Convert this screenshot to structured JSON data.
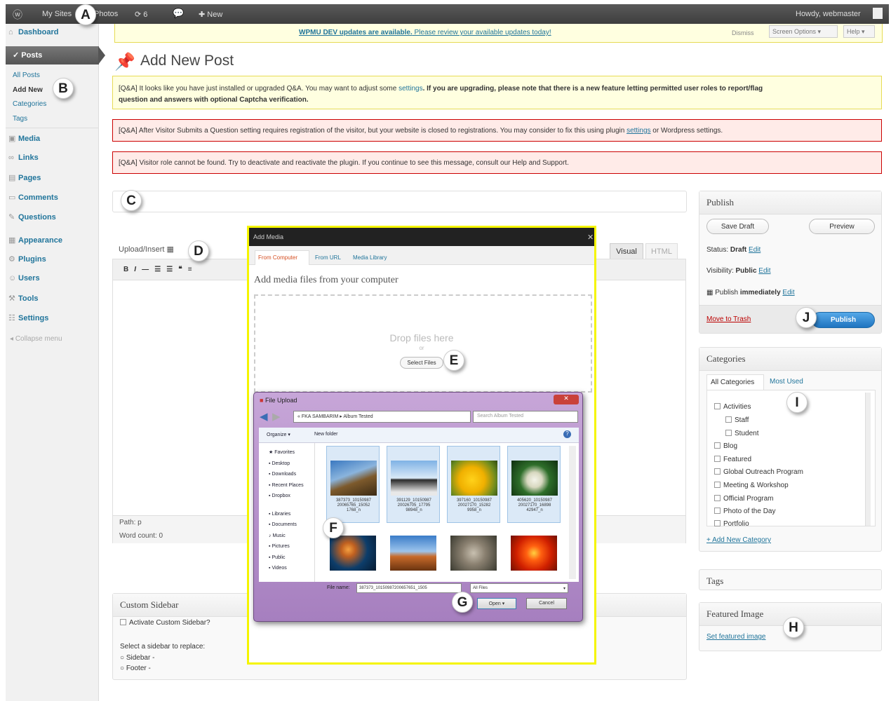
{
  "adminbar": {
    "wp_logo": "wordpress-logo",
    "my_sites": "My Sites",
    "site": "Photos",
    "updates": "6",
    "new": "New",
    "howdy": "Howdy, webmaster"
  },
  "sidebar": {
    "dashboard": "Dashboard",
    "posts": "Posts",
    "posts_sub": [
      "All Posts",
      "Add New",
      "Categories",
      "Tags"
    ],
    "items": [
      "Media",
      "Links",
      "Pages",
      "Comments",
      "Questions",
      "Appearance",
      "Plugins",
      "Users",
      "Tools",
      "Settings"
    ],
    "collapse": "Collapse menu"
  },
  "callouts": {
    "a": "A",
    "b": "B",
    "c": "C",
    "d": "D",
    "e": "E",
    "f": "F",
    "g": "G",
    "h": "H",
    "i": "I",
    "j": "J"
  },
  "topnotice": {
    "text": "WPMU DEV updates are available.",
    "link": "Please review your available updates today!",
    "dismiss": "Dismiss",
    "screen_options": "Screen Options",
    "help": "Help"
  },
  "page_title": "Add New Post",
  "notices": {
    "n1_pre": "[Q&A] It looks like you have just installed or upgraded Q&A. You may want to adjust some ",
    "n1_link": "settings",
    "n1_post": ". If you are upgrading, please note that there is a new feature letting permitted user roles to report/flag",
    "n1_line2": "question and answers with optional Captcha verification.",
    "n2_pre": "[Q&A] After Visitor Submits a Question setting requires registration of the visitor, but your website is closed to registrations. You may consider to fix this using plugin ",
    "n2_link": "settings",
    "n2_post": " or Wordpress settings.",
    "n3": "[Q&A] Visitor role cannot be found. Try to deactivate and reactivate the plugin. If you continue to see this message, consult our Help and Support."
  },
  "editor": {
    "upload_insert": "Upload/Insert",
    "tab_visual": "Visual",
    "tab_html": "HTML",
    "toolbar": [
      "B",
      "I",
      "—",
      "☰",
      "☰",
      "❝",
      "≡"
    ],
    "path": "Path: p",
    "word_count": "Word count: 0"
  },
  "custom_sidebar": {
    "title": "Custom Sidebar",
    "activate": "Activate Custom Sidebar?",
    "select": "Select a sidebar to replace:",
    "options": [
      "Sidebar -",
      "Footer -"
    ]
  },
  "publish": {
    "title": "Publish",
    "save_draft": "Save Draft",
    "preview": "Preview",
    "status_label": "Status:",
    "status_value": "Draft",
    "edit": "Edit",
    "visibility_label": "Visibility:",
    "visibility_value": "Public",
    "publish_label": "Publish",
    "publish_value": "immediately",
    "trash": "Move to Trash",
    "publish_button": "Publish"
  },
  "categories": {
    "title": "Categories",
    "tab_all": "All Categories",
    "tab_most": "Most Used",
    "items": [
      "Activities",
      "Staff",
      "Student",
      "Blog",
      "Featured",
      "Global Outreach Program",
      "Meeting & Workshop",
      "Official Program",
      "Photo of the Day",
      "Portfolio"
    ],
    "add_new": "+ Add New Category"
  },
  "tags": {
    "title": "Tags"
  },
  "featured": {
    "title": "Featured Image",
    "link": "Set featured image"
  },
  "media_dialog": {
    "title": "Add Media",
    "tabs": [
      "From Computer",
      "From URL",
      "Media Library"
    ],
    "heading": "Add media files from your computer",
    "drop": "Drop files here",
    "or": "or",
    "select_files": "Select Files"
  },
  "file_upload": {
    "title": "File Upload",
    "breadcrumb": "« FKA SAMBARIM ▸ Album Tested",
    "search": "Search Album Tested",
    "organize": "Organize ▾",
    "new_folder": "New folder",
    "nav": [
      "Favorites",
      "Desktop",
      "Downloads",
      "Recent Places",
      "Dropbox",
      "Libraries",
      "Documents",
      "Music",
      "Pictures",
      "Public",
      "Videos"
    ],
    "files": [
      "387373_10150987\n20065765_15052\n1768_n",
      "391129_10150987\n20026705_17795\n98948_n",
      "397160_10150987\n20027170_15282\n9958_n",
      "405620_10150987\n20027170_16898\n42947_n"
    ],
    "file_name_label": "File name:",
    "file_name_value": "387373_10150987200657651_1505",
    "file_type": "All Files",
    "open": "Open",
    "cancel": "Cancel"
  },
  "colors": {
    "accent": "#21759b",
    "highlight": "#f5f500",
    "publish_blue": "#2e8fd8"
  }
}
